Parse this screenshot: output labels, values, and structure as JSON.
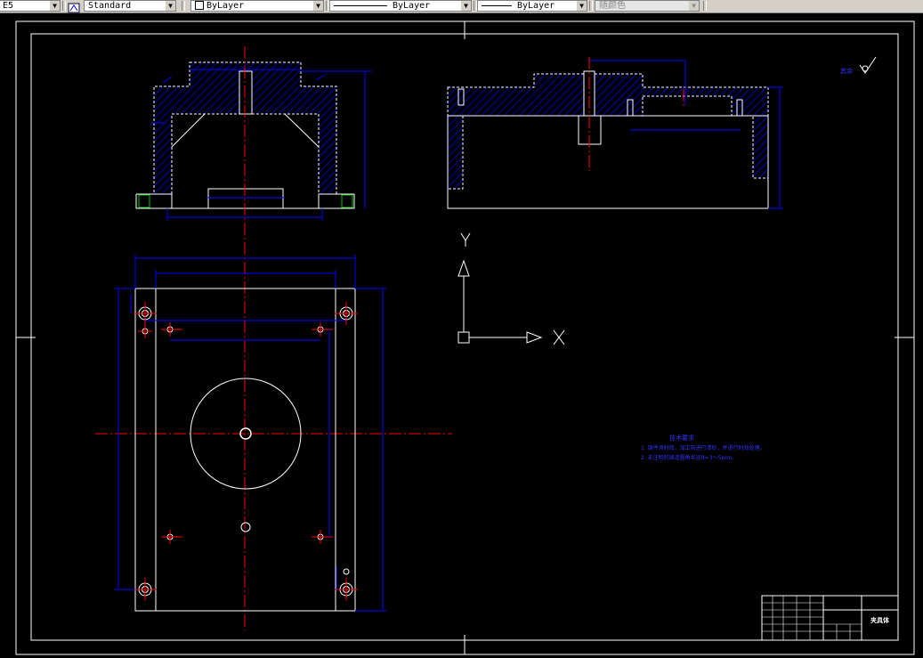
{
  "toolbar": {
    "style_left_partial": "E5",
    "text_style": "Standard",
    "layer": "ByLayer",
    "linetype": "ByLayer",
    "lineweight": "ByLayer",
    "plot_style": "随颜色"
  },
  "drawing": {
    "colors": {
      "background": "#000000",
      "frame": "#ffffff",
      "dimension": "#0000ff",
      "centerline": "#ff0000",
      "hatch": "#0000ff",
      "geometry": "#ffffff",
      "notes": "#3333ff",
      "leader_green": "#00c000"
    },
    "notes": {
      "heading": "技术要求",
      "line1": "1. 铸件须时效，加工前进行清砂，并进行时效处理。",
      "line2": "2. 未注明的铸造圆角半径R=3～5mm。"
    },
    "title_block": {
      "drawing_name": "夹具体"
    },
    "ucs": {
      "x_label": "X",
      "y_label": "Y"
    },
    "roughness_symbol_label": "其余"
  }
}
